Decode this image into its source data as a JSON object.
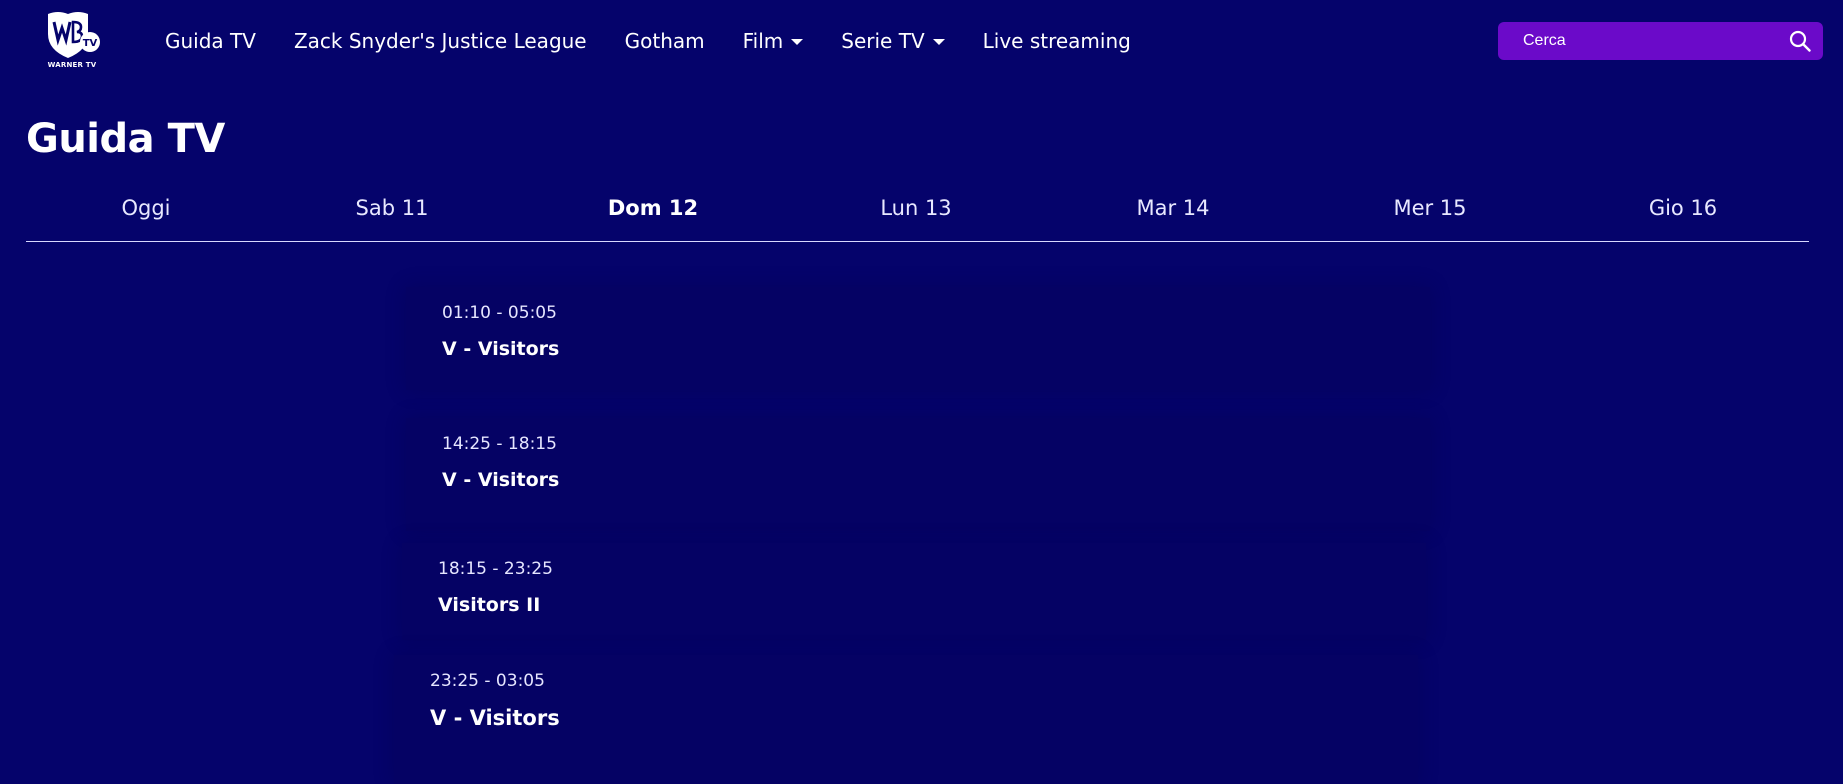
{
  "header": {
    "logo_text": "WARNER TV",
    "nav": [
      {
        "label": "Guida TV",
        "dropdown": false
      },
      {
        "label": "Zack Snyder's Justice League",
        "dropdown": false
      },
      {
        "label": "Gotham",
        "dropdown": false
      },
      {
        "label": "Film",
        "dropdown": true
      },
      {
        "label": "Serie TV",
        "dropdown": true
      },
      {
        "label": "Live streaming",
        "dropdown": false
      }
    ],
    "search": {
      "placeholder": "Cerca",
      "icon": "search-icon"
    }
  },
  "page_title": "Guida TV",
  "tabs": {
    "items": [
      "Oggi",
      "Sab 11",
      "Dom 12",
      "Lun 13",
      "Mar 14",
      "Mer 15",
      "Gio 16"
    ],
    "active": "Dom 12"
  },
  "schedule": [
    {
      "time": "01:10 - 05:05",
      "title": "V - Visitors"
    },
    {
      "time": "14:25 - 18:15",
      "title": "V - Visitors"
    },
    {
      "time": "18:15 - 23:25",
      "title": "Visitors II"
    },
    {
      "time": "23:25 - 03:05",
      "title": "V - Visitors"
    }
  ],
  "colors": {
    "background": "#05036b",
    "search_background": "#6b0ac9",
    "card_background": "#050264",
    "text": "#ffffff"
  }
}
